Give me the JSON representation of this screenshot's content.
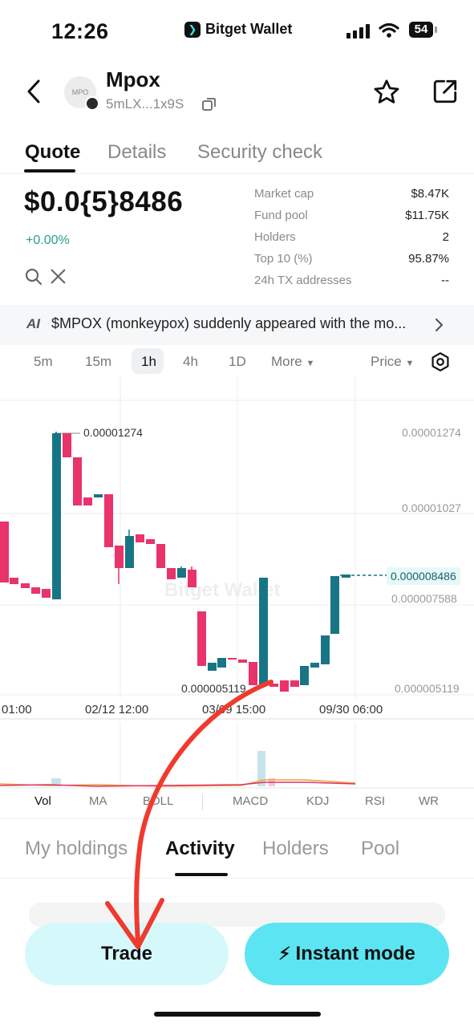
{
  "status_bar": {
    "time": "12:26",
    "app_name": "Bitget Wallet",
    "battery": "54"
  },
  "header": {
    "token_avatar_text": "MPO",
    "token_name": "Mpox",
    "token_address": "5mLX...1x9S"
  },
  "tabs": [
    {
      "label": "Quote",
      "active": true
    },
    {
      "label": "Details",
      "active": false
    },
    {
      "label": "Security check",
      "active": false
    }
  ],
  "price": {
    "value": "$0.0{5}8486",
    "change": "+0.00%"
  },
  "stats": [
    {
      "label": "Market cap",
      "value": "$8.47K"
    },
    {
      "label": "Fund pool",
      "value": "$11.75K"
    },
    {
      "label": "Holders",
      "value": "2"
    },
    {
      "label": "Top 10 (%)",
      "value": "95.87%"
    },
    {
      "label": "24h TX addresses",
      "value": "--"
    }
  ],
  "ai_banner": {
    "icon_text": "AI",
    "text": "$MPOX (monkeypox) suddenly appeared with the mo..."
  },
  "intervals": [
    {
      "label": "5m",
      "active": false
    },
    {
      "label": "15m",
      "active": false
    },
    {
      "label": "1h",
      "active": true
    },
    {
      "label": "4h",
      "active": false
    },
    {
      "label": "1D",
      "active": false
    }
  ],
  "more_label": "More",
  "price_mode_label": "Price",
  "chart": {
    "watermark": "Bitget Wallet",
    "high_label": "0.00001274",
    "low_label": "0.000005119",
    "current_price": "0.000008486",
    "axis_labels": [
      "0.00001274",
      "0.00001027",
      "0.000007588",
      "0.000005119"
    ],
    "time_labels": [
      "01:00",
      "02/12 12:00",
      "03/09 15:00",
      "09/30 06:00"
    ],
    "up_color": "#187586",
    "down_color": "#e8336b"
  },
  "indicators": [
    {
      "label": "Vol",
      "active": true
    },
    {
      "label": "MA",
      "active": false
    },
    {
      "label": "BOLL",
      "active": false
    },
    {
      "label": "MACD",
      "active": false
    },
    {
      "label": "KDJ",
      "active": false
    },
    {
      "label": "RSI",
      "active": false
    },
    {
      "label": "WR",
      "active": false
    }
  ],
  "sections": [
    {
      "label": "My holdings",
      "active": false
    },
    {
      "label": "Activity",
      "active": true
    },
    {
      "label": "Holders",
      "active": false
    },
    {
      "label": "Pool",
      "active": false
    }
  ],
  "buttons": {
    "trade": "Trade",
    "instant": "Instant mode"
  }
}
